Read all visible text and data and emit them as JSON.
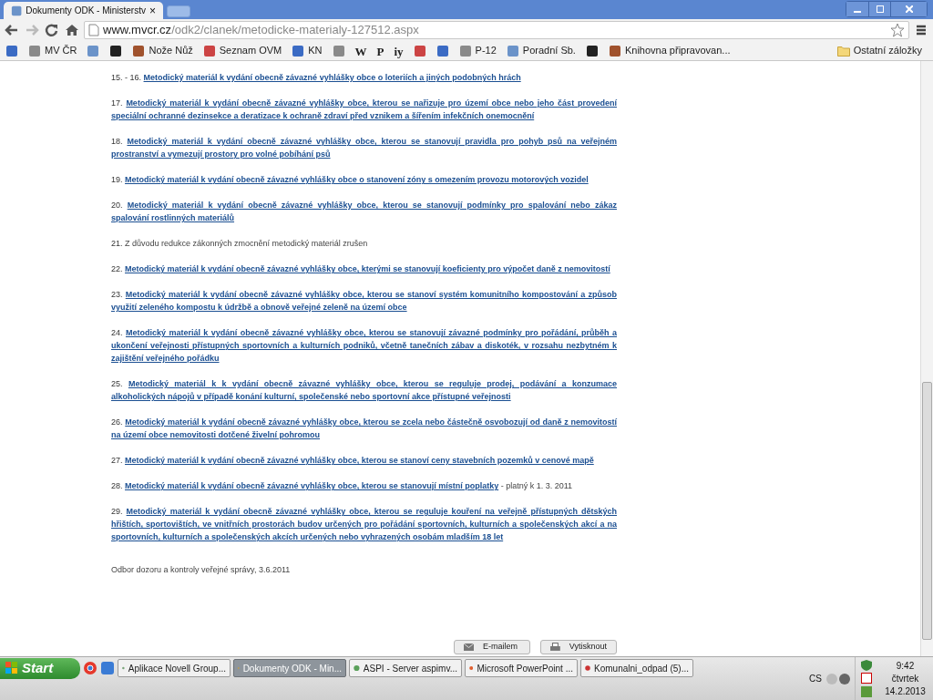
{
  "browser": {
    "tabs": [
      {
        "title": "Dokumenty ODK - Ministerstv",
        "close": "×",
        "selected": true
      }
    ],
    "url": {
      "host": "www.mvcr.cz",
      "path": "/odk2/clanek/metodicke-materialy-127512.aspx"
    },
    "bookmarks": [
      {
        "kind": "icon"
      },
      {
        "kind": "labeled",
        "label": "MV ČR"
      },
      {
        "kind": "icon"
      },
      {
        "kind": "icon"
      },
      {
        "kind": "labeled",
        "label": "Nože Nůž"
      },
      {
        "kind": "labeled",
        "label": "Seznam OVM"
      },
      {
        "kind": "labeled",
        "label": "KN"
      },
      {
        "kind": "icon"
      },
      {
        "kind": "text",
        "label": "W"
      },
      {
        "kind": "text",
        "label": "P"
      },
      {
        "kind": "text",
        "label": "iy"
      },
      {
        "kind": "icon"
      },
      {
        "kind": "icon"
      },
      {
        "kind": "labeled",
        "label": "P-12"
      },
      {
        "kind": "labeled",
        "label": "Poradní Sb."
      },
      {
        "kind": "icon"
      },
      {
        "kind": "labeled",
        "label": "Knihovna připravovan..."
      }
    ],
    "other_bookmarks": "Ostatní záložky"
  },
  "items": [
    {
      "kind": "link",
      "number": "15. - 16.",
      "text": "Metodický materiál k vydání obecně závazné vyhlášky obce o loteriích a jiných podobných hrách"
    },
    {
      "kind": "link",
      "number": "17.",
      "text": "Metodický materiál k vydání obecně závazné vyhlášky obce, kterou se nařizuje pro území obce nebo jeho část provedení speciální ochranné dezinsekce a deratizace k ochraně zdraví před vznikem a šířením infekčních onemocnění"
    },
    {
      "kind": "link",
      "number": "18.",
      "text": "Metodický materiál k vydání obecně závazné vyhlášky obce, kterou se stanovují pravidla pro pohyb psů na veřejném prostranství a vymezují prostory pro volné pobíhání psů"
    },
    {
      "kind": "link",
      "number": "19.",
      "text": "Metodický materiál k vydání obecně závazné vyhlášky obce o stanovení zóny s omezením provozu motorových vozidel"
    },
    {
      "kind": "link",
      "number": "20.",
      "text": "Metodický materiál k vydání obecně závazné vyhlášky obce, kterou se stanovují podmínky pro spalování nebo zákaz spalování rostlinných materiálů"
    },
    {
      "kind": "plain",
      "number": "21.",
      "text": "Z důvodu redukce zákonných zmocnění metodický materiál zrušen"
    },
    {
      "kind": "link",
      "number": "22.",
      "text": "Metodický materiál k vydání obecně závazné vyhlášky obce, kterými se stanovují koeficienty pro výpočet daně z nemovitostí"
    },
    {
      "kind": "link",
      "number": "23.",
      "text": "Metodický materiál k vydání obecně závazné vyhlášky obce, kterou se stanoví systém komunitního kompostování a způsob využití zeleného kompostu k údržbě a obnově veřejné zeleně na území obce"
    },
    {
      "kind": "link",
      "number": "24.",
      "text": "Metodický materiál k vydání obecně závazné vyhlášky obce, kterou se stanovují závazné podmínky pro pořádání, průběh a ukončení veřejnosti přístupných sportovních a kulturních podniků, včetně tanečních zábav a diskoték, v rozsahu nezbytném k zajištění veřejného pořádku"
    },
    {
      "kind": "link",
      "number": "25.",
      "text": "Metodický materiál k k vydání obecně závazné vyhlášky obce, kterou se reguluje prodej, podávání a konzumace alkoholických nápojů v případě konání kulturní, společenské nebo sportovní akce přístupné veřejnosti"
    },
    {
      "kind": "link",
      "number": "26.",
      "text": "Metodický  materiál k vydání obecně závazné vyhlášky obce, kterou se zcela nebo částečně osvobozují od daně z nemovitostí na území obce nemovitosti dotčené živelní pohromou"
    },
    {
      "kind": "link",
      "number": "27.",
      "text": "Metodický materiál k vydání obecně závazné vyhlášky obce, kterou se stanoví ceny stavebních pozemků v cenové mapě"
    },
    {
      "kind": "link",
      "number": "28.",
      "text": "Metodický materiál k vydání obecně závazné vyhlášky obce, kterou se stanovují místní poplatky",
      "suffix": "- platný k 1. 3. 2011"
    },
    {
      "kind": "link",
      "number": "29.",
      "text": "Metodický materiál k vydání obecně závazné vyhlášky obce, kterou se reguluje kouření na veřejně přístupných dětských hřištích, sportovištích, ve vnitřních prostorách budov určených pro pořádání sportovních, kulturních a společenských akcí a na sportovních, kulturních a společenských akcích určených nebo vyhrazených osobám mladším 18 let"
    }
  ],
  "footer": "Odbor dozoru a kontroly veřejné správy, 3.6.2011",
  "actions": [
    {
      "kind": "email",
      "label": "E-mailem"
    },
    {
      "kind": "print",
      "label": "Vytisknout"
    }
  ],
  "taskbar": {
    "start": "Start",
    "tasks": [
      {
        "label": "Aplikace Novell Group...",
        "selected": false
      },
      {
        "label": "Dokumenty ODK - Min...",
        "selected": true
      },
      {
        "label": "ASPI - Server aspimv...",
        "selected": false
      },
      {
        "label": "Microsoft PowerPoint ...",
        "selected": false
      },
      {
        "label": "Komunalni_odpad (5)...",
        "selected": false
      }
    ],
    "language": "CS",
    "time": "9:42",
    "day": "čtvrtek",
    "date": "14.2.2013"
  }
}
